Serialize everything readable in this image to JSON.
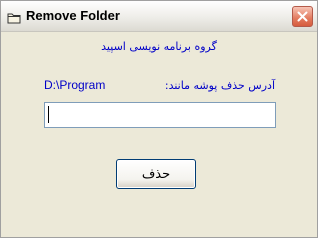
{
  "window": {
    "title": "Remove Folder",
    "icon": "folder-icon",
    "close_icon": "close-icon",
    "accent_close": "#d65c3e"
  },
  "content": {
    "heading": "گروه برنامه نویسی اسپید",
    "path_label": "D:\\Program",
    "address_label": "آدرس حذف پوشه مانند:",
    "path_input_value": "",
    "path_input_placeholder": "",
    "delete_button_label": "حذف"
  },
  "colors": {
    "label_blue": "#0000c8",
    "dialog_background": "#ece9d8"
  }
}
